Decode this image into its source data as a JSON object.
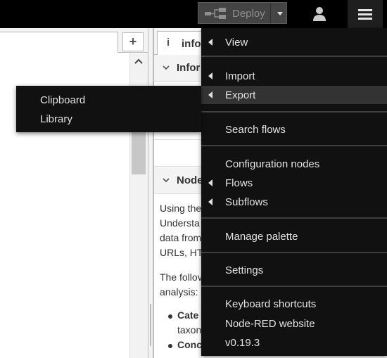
{
  "header": {
    "deploy_label": "Deploy",
    "icons": {
      "deploy": "deploy-flow-icon",
      "deploy_caret": "caret-down-icon",
      "user": "user-icon",
      "menu": "hamburger-menu-icon"
    }
  },
  "workspace": {
    "add_tab_label": "+"
  },
  "sidebar": {
    "tab_info_icon": "i",
    "tab_info_label": "info",
    "section1_title": "Infor",
    "section2_title": "Node",
    "body_lines": [
      "Using the",
      "Understa",
      "data from",
      "URLs, HT",
      "The follov",
      "analysis:"
    ],
    "bullets": [
      {
        "bold": "Cate",
        "rest": ""
      },
      {
        "bold": "",
        "rest": "taxon"
      },
      {
        "bold": "Conc",
        "rest": ""
      }
    ]
  },
  "main_menu": {
    "items": [
      {
        "label": "View",
        "submenu": true
      },
      {
        "label": "Import",
        "submenu": true
      },
      {
        "label": "Export",
        "submenu": true,
        "active": true
      },
      {
        "label": "Search flows",
        "submenu": false
      },
      {
        "label": "Configuration nodes",
        "submenu": false
      },
      {
        "label": "Flows",
        "submenu": true
      },
      {
        "label": "Subflows",
        "submenu": true
      },
      {
        "label": "Manage palette",
        "submenu": false
      },
      {
        "label": "Settings",
        "submenu": false
      },
      {
        "label": "Keyboard shortcuts",
        "submenu": false
      },
      {
        "label": "Node-RED website",
        "submenu": false
      },
      {
        "label": "v0.19.3",
        "submenu": false
      }
    ]
  },
  "export_submenu": {
    "items": [
      "Clipboard",
      "Library"
    ]
  },
  "colors": {
    "header_bg": "#000000",
    "menu_bg": "#111111",
    "menu_active_bg": "#333333",
    "menu_text": "#e2e2e2",
    "panel_bg": "#f3f3f3"
  }
}
